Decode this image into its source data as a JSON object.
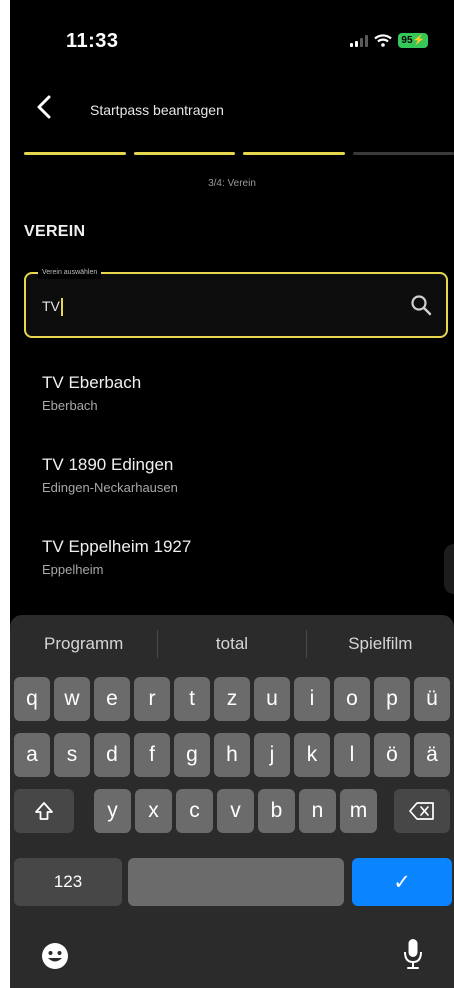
{
  "status_bar": {
    "time": "11:33",
    "battery": "95"
  },
  "header": {
    "title": "Startpass beantragen",
    "back_icon": "chevron-left-icon"
  },
  "progress": {
    "step": 3,
    "total": 4,
    "label": "3/4: Verein"
  },
  "section": {
    "title": "VEREIN"
  },
  "search": {
    "legend": "Verein auswählen",
    "value": "TV",
    "icon": "search-icon"
  },
  "results": [
    {
      "name": "TV Eberbach",
      "city": "Eberbach"
    },
    {
      "name": "TV 1890 Edingen",
      "city": "Edingen-Neckarhausen"
    },
    {
      "name": "TV Eppelheim 1927",
      "city": "Eppelheim"
    }
  ],
  "keyboard": {
    "suggestions": [
      "Programm",
      "total",
      "Spielfilm"
    ],
    "row1": [
      "q",
      "w",
      "e",
      "r",
      "t",
      "z",
      "u",
      "i",
      "o",
      "p",
      "ü"
    ],
    "row2": [
      "a",
      "s",
      "d",
      "f",
      "g",
      "h",
      "j",
      "k",
      "l",
      "ö",
      "ä"
    ],
    "row3": [
      "y",
      "x",
      "c",
      "v",
      "b",
      "n",
      "m"
    ],
    "numbers_label": "123",
    "done_label": "✓"
  },
  "colors": {
    "accent": "#e6d74e",
    "background": "#000000",
    "keyboard": "#2b2b2b",
    "key": "#6b6b6b",
    "blue": "#0a84ff"
  }
}
